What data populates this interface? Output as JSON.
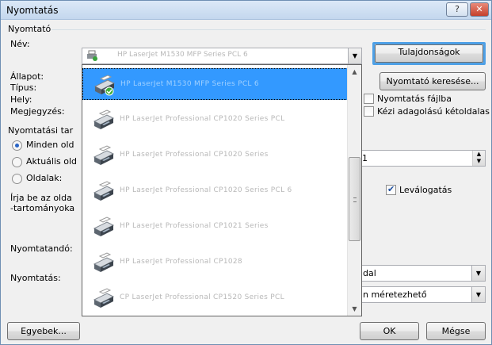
{
  "window": {
    "title": "Nyomtatás",
    "help_label": "?",
    "close_label": "✕"
  },
  "printer_group": {
    "label": "Nyomtató",
    "name_label": "Név:",
    "status_label": "Állapot:",
    "type_label": "Típus:",
    "where_label": "Hely:",
    "comment_label": "Megjegyzés:",
    "selected_printer": "HP LaserJet M1530 MFP Series PCL 6",
    "properties_button": "Tulajdonságok",
    "find_printer_button": "Nyomtató keresése...",
    "print_to_file_label": "Nyomtatás fájlba",
    "manual_duplex_label": "Kézi adagolású kétoldalas"
  },
  "printer_list": [
    {
      "name": "HP LaserJet M1530 MFP Series PCL 6",
      "selected": true
    },
    {
      "name": "HP LaserJet Professional CP1020 Series PCL",
      "selected": false
    },
    {
      "name": "HP LaserJet Professional CP1020 Series",
      "selected": false
    },
    {
      "name": "HP LaserJet Professional CP1020 Series PCL 6",
      "selected": false
    },
    {
      "name": "HP LaserJet Professional CP1021 Series",
      "selected": false
    },
    {
      "name": "HP LaserJet Professional CP1028",
      "selected": false
    },
    {
      "name": "CP LaserJet Professional CP1520 Series PCL",
      "selected": false
    }
  ],
  "range_group": {
    "label": "Nyomtatási tar",
    "all_label": "Minden old",
    "current_label": "Aktuális old",
    "pages_label": "Oldalak:",
    "hint_line1": "Írja be az olda",
    "hint_line2": "-tartományoka",
    "copies_value": "1",
    "collate_label": "Leválogatás"
  },
  "print_what": {
    "label": "Nyomtatandó:",
    "print_label": "Nyomtatás:",
    "what_value": "dal",
    "scale_value": "n méretezhető"
  },
  "footer": {
    "options_button": "Egyebek...",
    "ok_button": "OK",
    "cancel_button": "Mégse"
  },
  "colors": {
    "accent": "#3399ff",
    "focus": "#4ea0e6"
  }
}
